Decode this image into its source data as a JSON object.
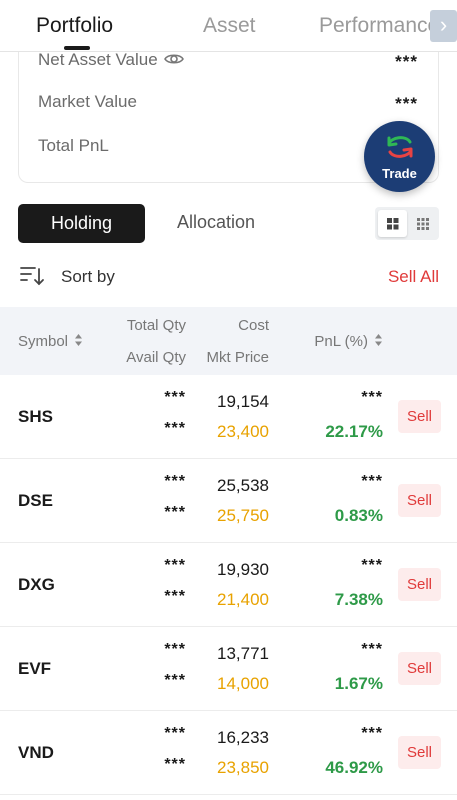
{
  "tabs": [
    {
      "label": "Portfolio",
      "active": true
    },
    {
      "label": "Asset",
      "active": false
    },
    {
      "label": "Performance",
      "active": false
    }
  ],
  "tab_arrow_icon": "chevron-right-icon",
  "summary": {
    "net_asset_label": "Net Asset Value",
    "net_asset_value": "***",
    "market_value_label": "Market Value",
    "market_value": "***",
    "total_pnl_label": "Total PnL",
    "total_pnl_value": "***"
  },
  "trade_button": {
    "label": "Trade",
    "icon": "swap-arrows-icon"
  },
  "segments": {
    "holding": "Holding",
    "allocation": "Allocation"
  },
  "sort": {
    "label": "Sort by",
    "sell_all": "Sell All"
  },
  "table_header": {
    "symbol": "Symbol",
    "total_qty": "Total Qty",
    "avail_qty": "Avail Qty",
    "cost": "Cost",
    "mkt_price": "Mkt Price",
    "pnl": "PnL (%)"
  },
  "rows": [
    {
      "symbol": "SHS",
      "total_qty": "***",
      "avail_qty": "***",
      "cost": "19,154",
      "mkt_price": "23,400",
      "pnl_value": "***",
      "pnl_pct": "22.17%",
      "sell": "Sell"
    },
    {
      "symbol": "DSE",
      "total_qty": "***",
      "avail_qty": "***",
      "cost": "25,538",
      "mkt_price": "25,750",
      "pnl_value": "***",
      "pnl_pct": "0.83%",
      "sell": "Sell"
    },
    {
      "symbol": "DXG",
      "total_qty": "***",
      "avail_qty": "***",
      "cost": "19,930",
      "mkt_price": "21,400",
      "pnl_value": "***",
      "pnl_pct": "7.38%",
      "sell": "Sell"
    },
    {
      "symbol": "EVF",
      "total_qty": "***",
      "avail_qty": "***",
      "cost": "13,771",
      "mkt_price": "14,000",
      "pnl_value": "***",
      "pnl_pct": "1.67%",
      "sell": "Sell"
    },
    {
      "symbol": "VND",
      "total_qty": "***",
      "avail_qty": "***",
      "cost": "16,233",
      "mkt_price": "23,850",
      "pnl_value": "***",
      "pnl_pct": "46.92%",
      "sell": "Sell"
    }
  ],
  "colors": {
    "accent_dark": "#1a1a1a",
    "sell_red": "#e03a3a",
    "market_price_amber": "#e8a200",
    "pnl_green": "#2e9a48",
    "trade_navy": "#1c3d75"
  }
}
